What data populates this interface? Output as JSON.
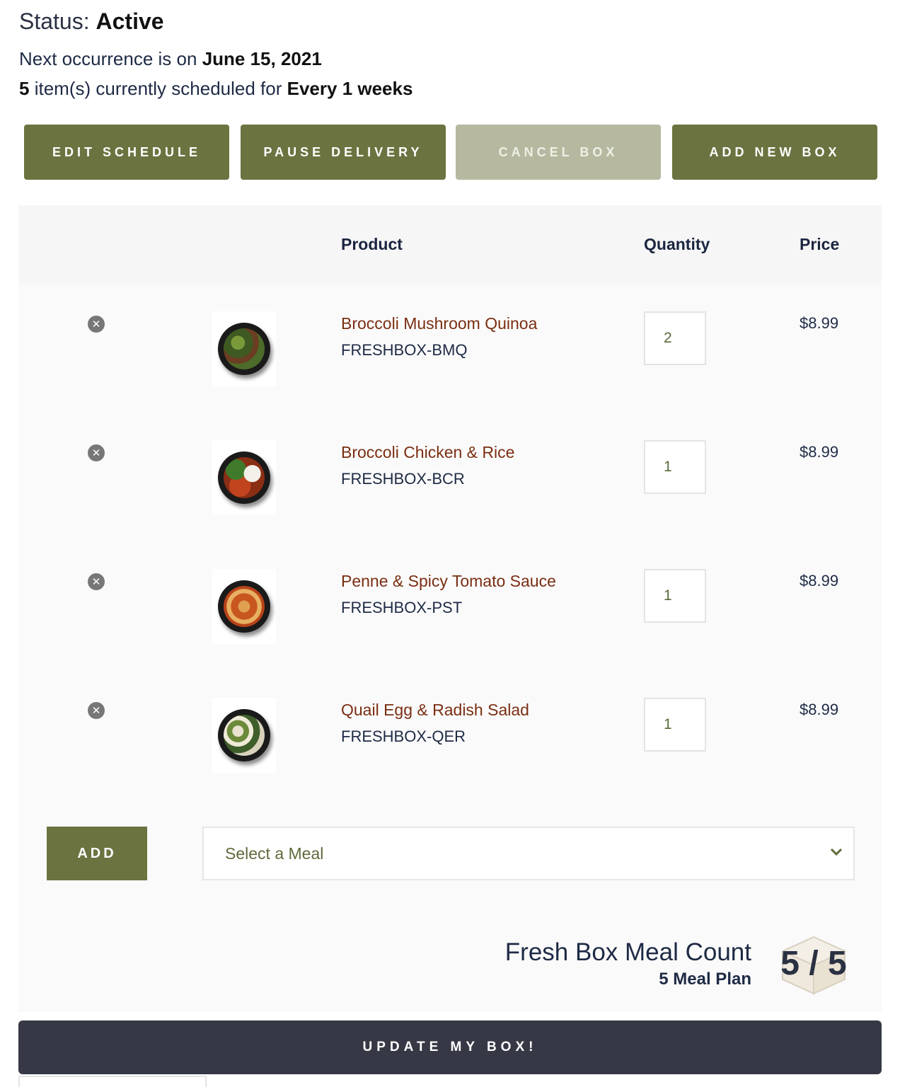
{
  "status": {
    "label": "Status:",
    "value": "Active"
  },
  "next": {
    "text": "Next occurrence is on",
    "date": "June 15, 2021"
  },
  "schedule": {
    "count": "5",
    "text": "item(s) currently scheduled for",
    "frequency": "Every 1 weeks"
  },
  "buttons": {
    "edit": "EDIT SCHEDULE",
    "pause": "PAUSE DELIVERY",
    "cancel": "CANCEL BOX",
    "add_new": "ADD NEW BOX"
  },
  "table": {
    "headers": {
      "product": "Product",
      "quantity": "Quantity",
      "price": "Price"
    },
    "rows": [
      {
        "name": "Broccoli Mushroom Quinoa",
        "sku": "FRESHBOX-BMQ",
        "qty": "2",
        "price": "$8.99",
        "icon": "remove-icon"
      },
      {
        "name": "Broccoli Chicken & Rice",
        "sku": "FRESHBOX-BCR",
        "qty": "1",
        "price": "$8.99",
        "icon": "remove-icon"
      },
      {
        "name": "Penne & Spicy Tomato Sauce",
        "sku": "FRESHBOX-PST",
        "qty": "1",
        "price": "$8.99",
        "icon": "remove-icon"
      },
      {
        "name": "Quail Egg & Radish Salad",
        "sku": "FRESHBOX-QER",
        "qty": "1",
        "price": "$8.99",
        "icon": "remove-icon"
      }
    ]
  },
  "add": {
    "button": "ADD",
    "select_placeholder": "Select a Meal"
  },
  "meal_count": {
    "title": "Fresh Box Meal Count",
    "plan": "5 Meal Plan",
    "current": "5",
    "separator": "/",
    "total": "5"
  },
  "update_button": "UPDATE MY BOX!",
  "colors": {
    "olive": "#6b7340",
    "olive_disabled": "#b6b9a0",
    "dark": "#363945",
    "product_link": "#7a2e12"
  }
}
